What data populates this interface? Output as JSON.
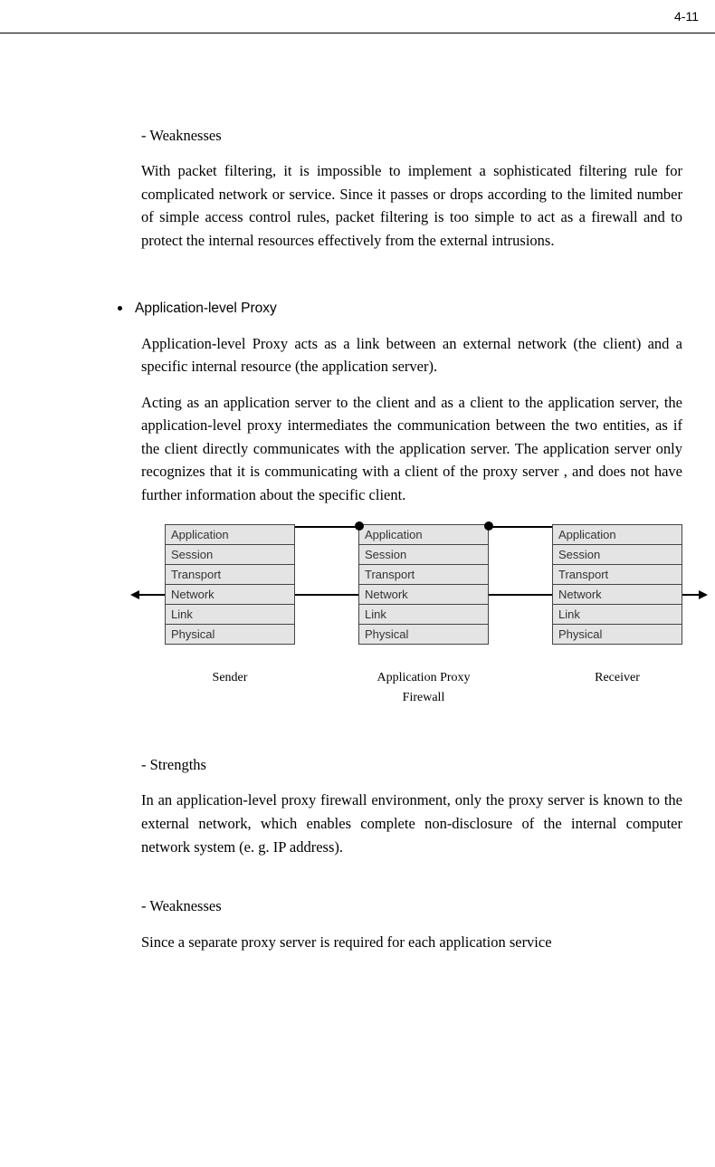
{
  "page_number": "4-11",
  "section_weaknesses1_head": "- Weaknesses",
  "section_weaknesses1_body": "With packet filtering, it is impossible to implement a sophisticated filtering rule for complicated network or service. Since it passes or drops according to the limited number of simple access control rules, packet filtering is too simple to act as a firewall and to protect the internal resources effectively from the external intrusions.",
  "bullet_heading": "Application-level Proxy",
  "proxy_para1": "Application-level Proxy acts as a link between an external network (the client) and a specific internal resource (the application server).",
  "proxy_para2": "Acting as an application server to the client and as a client to the application server, the application-level proxy intermediates the communication between the two entities, as if the client directly communicates with the application server. The application server only recognizes that it is communicating with a client of the proxy server , and does not have further information about the specific client.",
  "layers": [
    "Application",
    "Session",
    "Transport",
    "Network",
    "Link",
    "Physical"
  ],
  "diagram_labels": {
    "sender": "Sender",
    "middle": "Application Proxy Firewall",
    "receiver": "Receiver"
  },
  "section_strengths_head": "- Strengths",
  "section_strengths_body": "In an application-level proxy firewall environment, only the proxy server  is known to the external network, which enables complete non-disclosure of the internal computer network system (e. g. IP address).",
  "section_weaknesses2_head": "- Weaknesses",
  "section_weaknesses2_body": "Since a separate proxy server is required for each application service"
}
